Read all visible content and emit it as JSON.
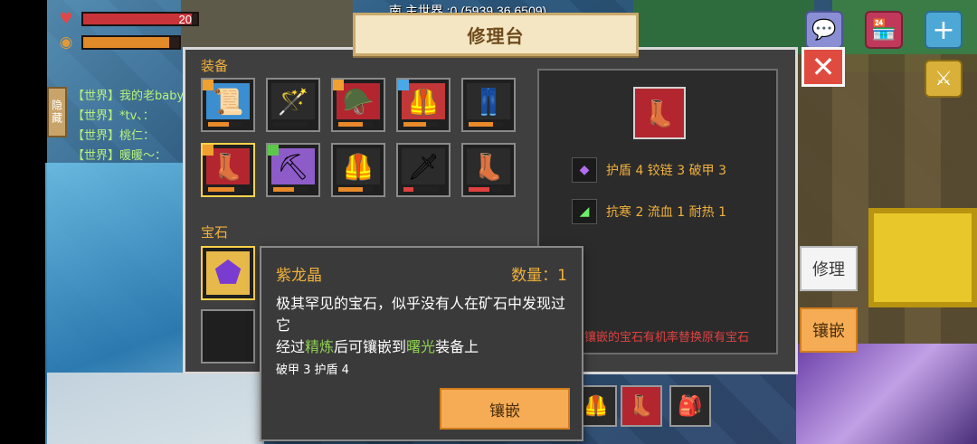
{
  "hud": {
    "health_value": "20",
    "health_fraction": 0.95,
    "hunger_fraction": 0.9,
    "coordinates_text": "南  主世界 :0 (5939,36,6509)"
  },
  "chat": {
    "hide_label": "隐藏",
    "lines": [
      "【世界】我的老baby",
      "【世界】*tv、：",
      "【世界】桃仁：",
      "【世界】暖暖～："
    ]
  },
  "panel": {
    "title": "修理台",
    "close_label": "✕",
    "equipment_label": "装备",
    "gems_label": "宝石",
    "equipment": [
      {
        "icon": "scroll-icon",
        "glyph": "📜",
        "bg": "#3b8ecf",
        "durability": 0.6,
        "dur_color": "#e88a2a",
        "tier_color": "#f0a030"
      },
      {
        "icon": "rod-icon",
        "glyph": "🪄",
        "bg": "#2b2b2b",
        "durability": 0.0,
        "dur_color": "#e88a2a",
        "tier_color": ""
      },
      {
        "icon": "helmet-icon",
        "glyph": "🪖",
        "bg": "#b3262f",
        "durability": 0.7,
        "dur_color": "#e88a2a",
        "tier_color": "#f0a030"
      },
      {
        "icon": "chestplate-icon",
        "glyph": "🦺",
        "bg": "#c23838",
        "durability": 0.65,
        "dur_color": "#e88a2a",
        "tier_color": "#4aa8e8"
      },
      {
        "icon": "leggings-icon",
        "glyph": "👖",
        "bg": "#2b2b2b",
        "durability": 0.7,
        "dur_color": "#e88a2a",
        "tier_color": ""
      },
      {
        "icon": "boots-icon",
        "glyph": "👢",
        "bg": "#b3262f",
        "durability": 0.75,
        "dur_color": "#e88a2a",
        "tier_color": "#f0a030"
      },
      {
        "icon": "pickaxe-icon",
        "glyph": "⛏",
        "bg": "#8d5cc9",
        "durability": 0.6,
        "dur_color": "#e88a2a",
        "tier_color": "#5cc84a"
      },
      {
        "icon": "gold-chestplate-icon",
        "glyph": "🦺",
        "bg": "#2b2b2b",
        "durability": 0.7,
        "dur_color": "#e88a2a",
        "tier_color": ""
      },
      {
        "icon": "staff-icon",
        "glyph": "🗡",
        "bg": "#2b2b2b",
        "durability": 0.3,
        "dur_color": "#e04040",
        "tier_color": ""
      },
      {
        "icon": "gold-boots-icon",
        "glyph": "👢",
        "bg": "#2b2b2b",
        "durability": 0.6,
        "dur_color": "#e04040",
        "tier_color": ""
      }
    ],
    "selected_gem": {
      "icon": "purple-crystal-icon",
      "glyph": "⬟",
      "bg": "#e7b94a"
    },
    "preview": {
      "icon": "boots-icon",
      "glyph": "👢"
    },
    "attributes": [
      {
        "icon": "purple-gem-icon",
        "glyph": "◆",
        "color": "#b36cf0",
        "text": "护盾 4   铰链 3   破甲 3"
      },
      {
        "icon": "green-gem-icon",
        "glyph": "◢",
        "color": "#6cf06c",
        "text": "抗寒 2   流血 1   耐热 1"
      }
    ],
    "warning": "镶嵌的宝石有机率替换原有宝石",
    "repair_label": "修理",
    "inlay_label": "镶嵌"
  },
  "tooltip": {
    "name": "紫龙晶",
    "quantity": "数量：1",
    "desc_line1": "极其罕见的宝石，似乎没有人在矿石中发现过它",
    "desc_line2_pre": "经过",
    "desc_hl1": "精炼",
    "desc_line2_mid": "后可镶嵌到",
    "desc_hl2": "曙光",
    "desc_line2_post": "装备上",
    "stats": "破甲 3    护盾 4",
    "inlay_label": "镶嵌"
  },
  "hotbar": [
    {
      "icon": "chestplate-icon",
      "glyph": "🦺"
    },
    {
      "icon": "boots-icon",
      "glyph": "👢"
    },
    {
      "icon": "backpack-icon",
      "glyph": "🎒"
    }
  ]
}
